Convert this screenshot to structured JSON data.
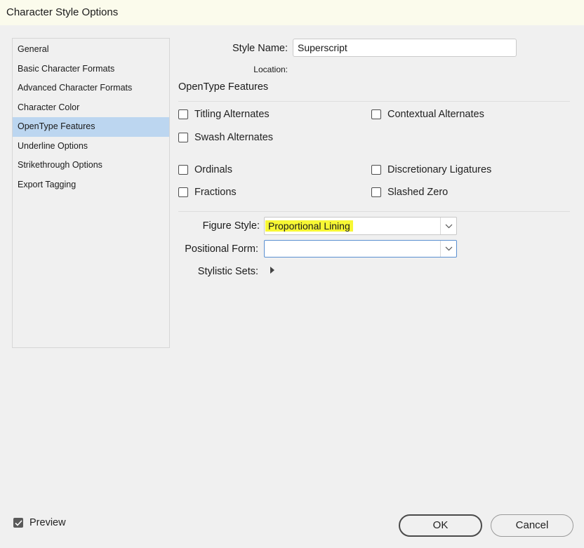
{
  "window": {
    "title": "Character Style Options"
  },
  "sidebar": {
    "items": [
      {
        "label": "General"
      },
      {
        "label": "Basic Character Formats"
      },
      {
        "label": "Advanced Character Formats"
      },
      {
        "label": "Character Color"
      },
      {
        "label": "OpenType Features"
      },
      {
        "label": "Underline Options"
      },
      {
        "label": "Strikethrough Options"
      },
      {
        "label": "Export Tagging"
      }
    ],
    "selected": "OpenType Features"
  },
  "form": {
    "style_name_label": "Style Name:",
    "style_name_value": "Superscript",
    "location_label": "Location:"
  },
  "opentype": {
    "section_title": "OpenType Features",
    "checkboxes": {
      "titling_alternates": {
        "label": "Titling Alternates",
        "checked": false
      },
      "contextual_alternates": {
        "label": "Contextual Alternates",
        "checked": false
      },
      "swash_alternates": {
        "label": "Swash Alternates",
        "checked": false
      },
      "ordinals": {
        "label": "Ordinals",
        "checked": false
      },
      "discretionary_ligatures": {
        "label": "Discretionary Ligatures",
        "checked": false
      },
      "fractions": {
        "label": "Fractions",
        "checked": false
      },
      "slashed_zero": {
        "label": "Slashed Zero",
        "checked": false
      }
    },
    "figure_style_label": "Figure Style:",
    "figure_style_value": "Proportional Lining",
    "positional_form_label": "Positional Form:",
    "positional_form_value": "",
    "stylistic_sets_label": "Stylistic Sets:"
  },
  "footer": {
    "preview_label": "Preview",
    "preview_checked": true,
    "ok_label": "OK",
    "cancel_label": "Cancel"
  },
  "colors": {
    "highlight": "#f7f734",
    "selection": "#bcd6f0",
    "focus": "#5a8fd0"
  }
}
